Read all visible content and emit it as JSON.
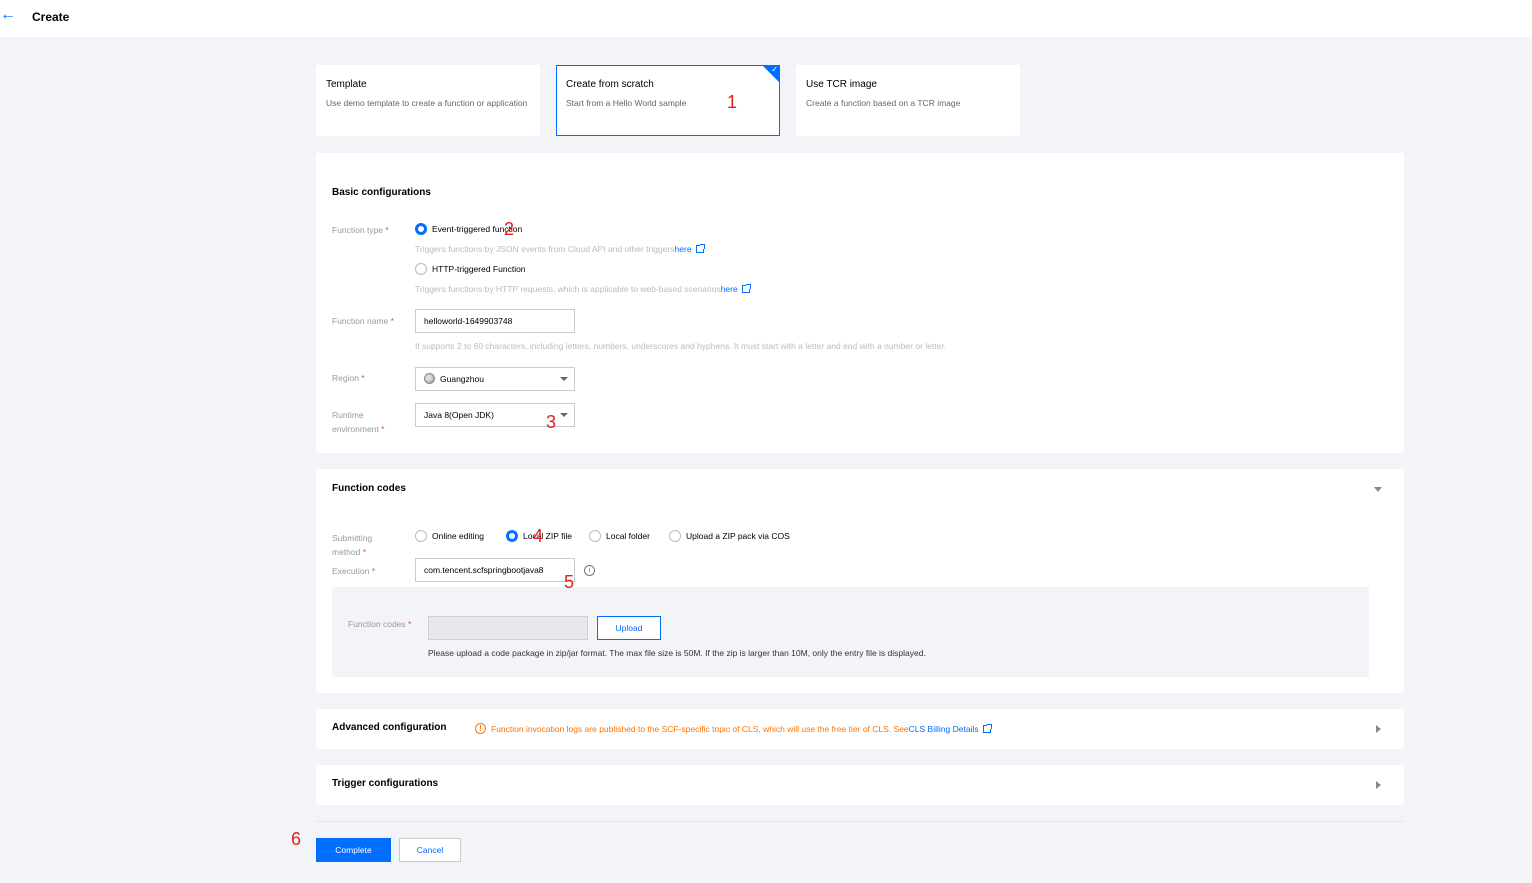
{
  "header": {
    "title": "Create"
  },
  "modes": [
    {
      "title": "Template",
      "desc": "Use demo template to create a function or application"
    },
    {
      "title": "Create from scratch",
      "desc": "Start from a Hello World sample"
    },
    {
      "title": "Use TCR image",
      "desc": "Create a function based on a TCR image"
    }
  ],
  "basic": {
    "title": "Basic configurations",
    "function_type_label": "Function type",
    "event_option": "Event-triggered function",
    "event_hint": "Triggers functions by JSON events from Cloud API and other triggers",
    "http_option": "HTTP-triggered Function",
    "http_hint": "Triggers functions by HTTP requests, which is applicable to web-based scenarios",
    "here_link": "here",
    "function_name_label": "Function name",
    "function_name_value": "helloworld-1649903748",
    "function_name_hint": "It supports 2 to 60 characters, including letters, numbers, underscores and hyphens. It must start with a letter and end with a number or letter.",
    "region_label": "Region",
    "region_value": "Guangzhou",
    "runtime_label_1": "Runtime",
    "runtime_label_2": "environment",
    "runtime_value": "Java 8(Open JDK)"
  },
  "codes": {
    "title": "Function codes",
    "submit_label_1": "Submitting",
    "submit_label_2": "method",
    "options": [
      "Online editing",
      "Local ZIP file",
      "Local folder",
      "Upload a ZIP pack via COS"
    ],
    "execution_label": "Execution",
    "execution_value": "com.tencent.scfspringbootjava8",
    "upload_label": "Function codes",
    "upload_button": "Upload",
    "upload_note": "Please upload a code package in zip/jar format. The max file size is 50M. If the zip is larger than 10M, only the entry file is displayed."
  },
  "advanced": {
    "title": "Advanced configuration",
    "warning": "Function invocation logs are published to the SCF-specific topic of CLS, which will use the free tier of CLS. See ",
    "warning_link": "CLS Billing Details"
  },
  "trigger": {
    "title": "Trigger configurations"
  },
  "actions": {
    "complete": "Complete",
    "cancel": "Cancel"
  },
  "required_mark": "*",
  "annotations": [
    "1",
    "2",
    "3",
    "4",
    "5",
    "6"
  ],
  "colors": {
    "accent": "#006eff",
    "warning": "#ff7200",
    "annotation": "#e02020"
  }
}
